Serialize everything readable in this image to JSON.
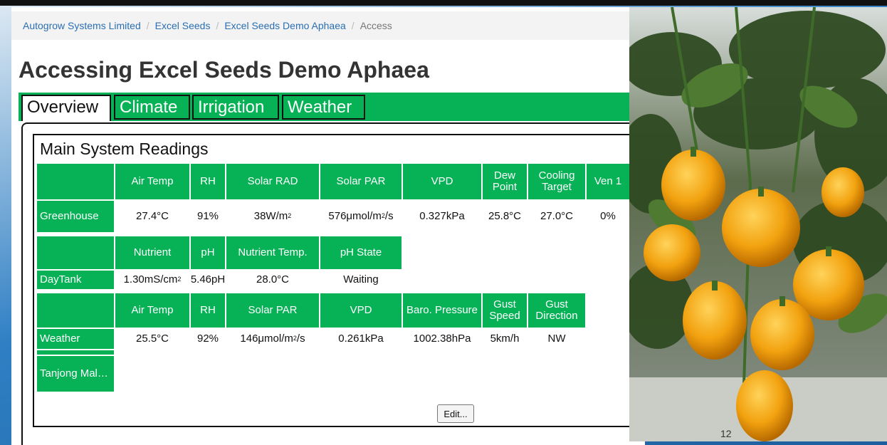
{
  "breadcrumb": {
    "items": [
      "Autogrow Systems Limited",
      "Excel Seeds",
      "Excel Seeds Demo Aphaea"
    ],
    "current": "Access"
  },
  "page_title": "Accessing Excel Seeds Demo Aphaea",
  "tabs": [
    "Overview",
    "Climate",
    "Irrigation",
    "Weather"
  ],
  "card": {
    "title": "Main System Readings",
    "greenhouse": {
      "label": "Greenhouse",
      "headers": [
        "Air Temp",
        "RH",
        "Solar RAD",
        "Solar PAR",
        "VPD",
        "Dew Point",
        "Cooling Target",
        "Ven 1"
      ],
      "values": [
        "27.4°C",
        "91%",
        "38W/m",
        "576μmol/m",
        "0.327kPa",
        "25.8°C",
        "27.0°C",
        "0%"
      ]
    },
    "daytank": {
      "label": "DayTank",
      "headers": [
        "Nutrient",
        "pH",
        "Nutrient Temp.",
        "pH State"
      ],
      "values": [
        "1.30mS/cm",
        "5.46pH",
        "28.0°C",
        "Waiting"
      ]
    },
    "weather": {
      "label": "Weather",
      "headers": [
        "Air Temp",
        "RH",
        "Solar PAR",
        "VPD",
        "Baro. Pressure",
        "Gust Speed",
        "Gust Direction"
      ],
      "values": [
        "25.5°C",
        "92%",
        "146μmol/m",
        "0.261kPa",
        "1002.38hPa",
        "5km/h",
        "NW"
      ]
    },
    "tanjong": {
      "label": "Tanjong Mal…"
    },
    "edit_label": "Edit..."
  },
  "units": {
    "squared": "2",
    "per_second": "/s"
  },
  "photo": {
    "label": "12"
  },
  "colors": {
    "accent": "#06b255",
    "link": "#2a6fb3",
    "pepper": "#f2a20f"
  }
}
